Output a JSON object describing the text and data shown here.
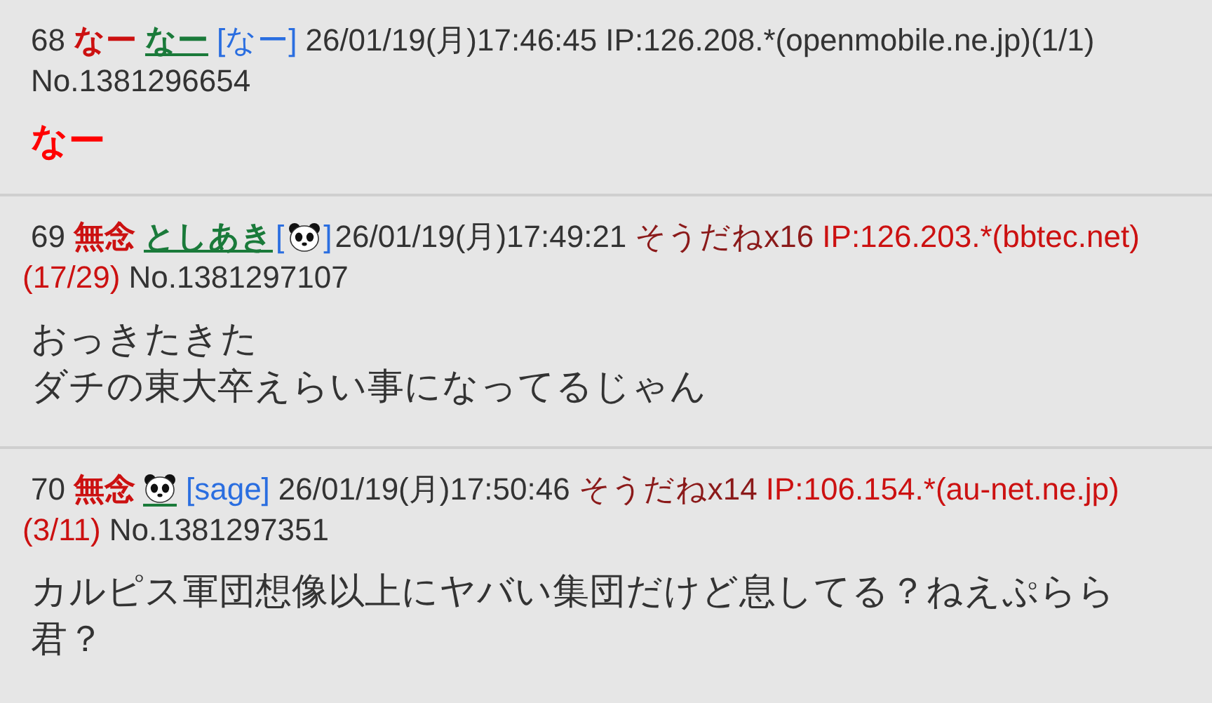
{
  "posts": [
    {
      "number": "68",
      "title": "なー",
      "name": {
        "kind": "text",
        "text": "なー"
      },
      "mail": {
        "kind": "text",
        "text": "[なー]"
      },
      "date": "26/01/19(月)17:46:45",
      "ip": "IP:126.208.*(openmobile.ne.jp)",
      "count": "(1/1)",
      "highlighted": false,
      "no": "No.1381296654",
      "emphasized": true,
      "body": [
        "なー"
      ]
    },
    {
      "number": "69",
      "title": "無念",
      "name": {
        "kind": "text",
        "text": "としあき"
      },
      "mail": {
        "kind": "icon",
        "open": "[",
        "close": "]"
      },
      "date": "26/01/19(月)17:49:21",
      "soudane": "そうだねx16",
      "ip": "IP:126.203.*(bbtec.net)",
      "count": "(17/29)",
      "highlighted": true,
      "no": "No.1381297107",
      "emphasized": false,
      "body": [
        "おっきたきた",
        "ダチの東大卒えらい事になってるじゃん"
      ]
    },
    {
      "number": "70",
      "title": "無念",
      "name": {
        "kind": "icon"
      },
      "mail": {
        "kind": "text",
        "text": "[sage]"
      },
      "date": "26/01/19(月)17:50:46",
      "soudane": "そうだねx14",
      "ip": "IP:106.154.*(au-net.ne.jp)",
      "count": "(3/11)",
      "highlighted": true,
      "no": "No.1381297351",
      "emphasized": false,
      "body": [
        "カルピス軍団想像以上にヤバい集団だけど息してる？ねえぷらら君？"
      ]
    }
  ]
}
